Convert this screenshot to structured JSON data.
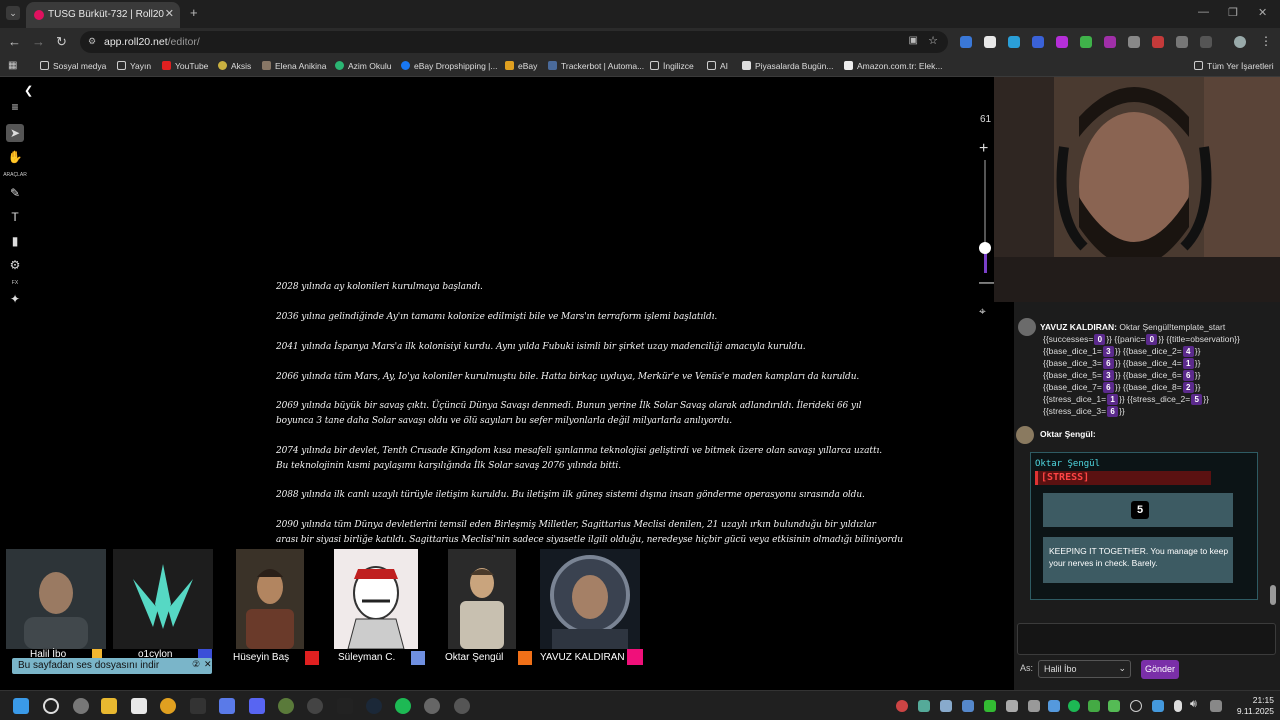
{
  "browser": {
    "tab_title": "TUSG Bürküt-732 | Roll20",
    "url_host": "app.roll20.net",
    "url_path": "/editor/",
    "bookmarks": [
      "Sosyal medya",
      "Yayın",
      "YouTube",
      "Aksis",
      "Elena Anikina",
      "Azim Okulu",
      "eBay Dropshipping |...",
      "eBay",
      "Trackerbot | Automa...",
      "İngilizce",
      "AI",
      "Piyasalarda Bugün...",
      "Amazon.com.tr: Elek..."
    ],
    "all_bookmarks": "Tüm Yer İşaretleri"
  },
  "toolbar": {
    "tools_label": "ARAÇLAR",
    "fx_label": "FX"
  },
  "zoom": {
    "value": "61"
  },
  "lore": [
    "2028 yılında ay kolonileri kurulmaya başlandı.",
    "2036 yılına gelindiğinde Ay'ın tamamı kolonize edilmişti bile ve Mars'ın terraform işlemi başlatıldı.",
    "2041 yılında İspanya Mars'a ilk kolonisiyi kurdu. Aynı yılda Fubuki isimli bir şirket uzay madenciliği amacıyla kuruldu.",
    "2066 yılında tüm Mars, Ay, Io'ya koloniler kurulmuştu bile. Hatta birkaç uyduya, Merkür'e ve Venüs'e maden kampları da kuruldu.",
    "2069 yılında büyük bir savaş çıktı. Üçüncü Dünya Savaşı denmedi. Bunun yerine İlk Solar Savaş olarak adlandırıldı. İlerideki 66 yıl",
    "boyunca 3 tane daha Solar savaşı oldu ve ölü sayıları bu sefer milyonlarla değil milyarlarla anılıyordu.",
    "2074 yılında bir devlet, Tenth Crusade Kingdom kısa mesafeli ışınlanma teknolojisi geliştirdi ve bitmek üzere olan savaşı yıllarca uzattı.",
    "Bu teknolojinin kısmi paylaşımı karşılığında İlk Solar savaş 2076 yılında bitti.",
    "2088 yılında ilk canlı uzaylı türüyle iletişim kuruldu. Bu iletişim ilk güneş sistemi dışına insan gönderme operasyonu sırasında oldu.",
    "2090 yılında tüm Dünya devletlerini temsil eden Birleşmiş Milletler, Sagittarius Meclisi denilen, 21 uzaylı ırkın bulunduğu bir yıldızlar",
    "arası bir siyasi birliğe katıldı. Sagittarius Meclisi'nin sadece siyasetle ilgili olduğu, neredeyse hiçbir gücü veya etkisinin olmadığı biliniyordu"
  ],
  "players": [
    {
      "name": "Halil İbo",
      "color": "#f2b630"
    },
    {
      "name": "o1cylon",
      "color": "#3b4fd8"
    },
    {
      "name": "Hüseyin Baş",
      "color": "#e02020"
    },
    {
      "name": "Süleyman C.",
      "color": "#6f8fe0"
    },
    {
      "name": "Oktar Şengül",
      "color": "#f07018"
    },
    {
      "name": "YAVUZ KALDIRAN",
      "color": "#f0107a"
    }
  ],
  "audio_notice": "Bu sayfadan ses dosyasını indir",
  "chat": {
    "msg1_sender": "YAVUZ KALDIRAN:",
    "msg1_intro": "Oktar Şengül!template_start",
    "rolls": {
      "successes": "0",
      "panic": "0",
      "title": "observation",
      "base_dice_1": "3",
      "base_dice_2": "4",
      "base_dice_3": "6",
      "base_dice_4": "1",
      "base_dice_5": "3",
      "base_dice_6": "6",
      "base_dice_7": "6",
      "base_dice_8": "2",
      "stress_dice_1": "1",
      "stress_dice_2": "5",
      "stress_dice_3": "6"
    },
    "msg2_sender": "Oktar Şengül:",
    "card": {
      "name": "Oktar Şengül",
      "tag": "[STRESS]",
      "result": "5",
      "description": "KEEPING IT TOGETHER. You manage to keep your nerves in check. Barely."
    },
    "as_label": "As:",
    "as_value": "Halil İbo",
    "send_label": "Gönder"
  },
  "taskbar": {
    "time": "21:15",
    "date": "9.11.2025"
  }
}
